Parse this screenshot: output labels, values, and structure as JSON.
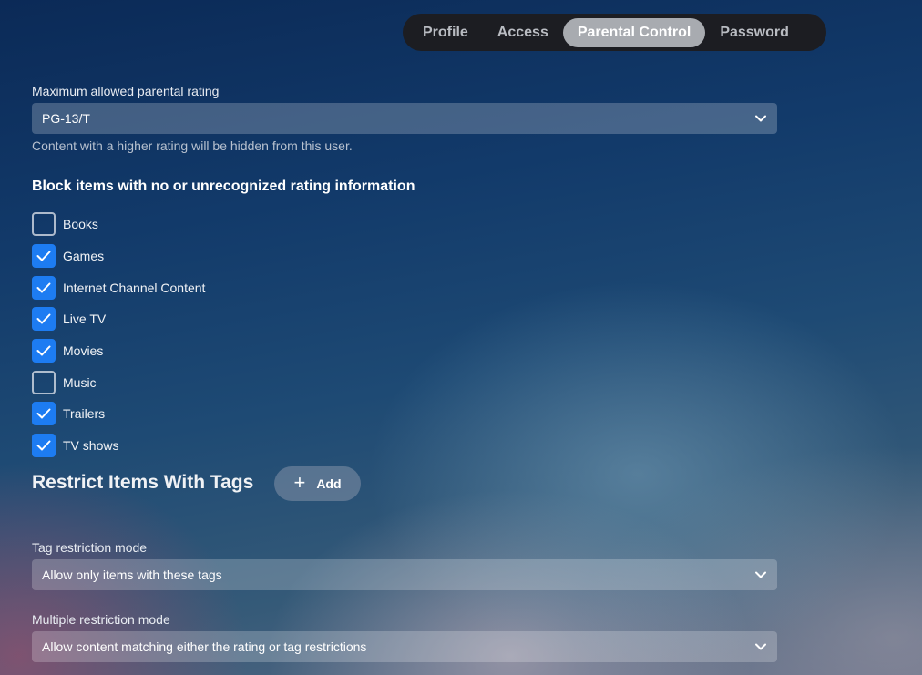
{
  "tabs": [
    {
      "label": "Profile",
      "active": false
    },
    {
      "label": "Access",
      "active": false
    },
    {
      "label": "Parental Control",
      "active": true
    },
    {
      "label": "Password",
      "active": false
    }
  ],
  "parental_rating": {
    "label": "Maximum allowed parental rating",
    "value": "PG-13/T",
    "helper": "Content with a higher rating will be hidden from this user."
  },
  "block_unrated": {
    "heading": "Block items with no or unrecognized rating information",
    "items": [
      {
        "label": "Books",
        "checked": false
      },
      {
        "label": "Games",
        "checked": true
      },
      {
        "label": "Internet Channel Content",
        "checked": true
      },
      {
        "label": "Live TV",
        "checked": true
      },
      {
        "label": "Movies",
        "checked": true
      },
      {
        "label": "Music",
        "checked": false
      },
      {
        "label": "Trailers",
        "checked": true
      },
      {
        "label": "TV shows",
        "checked": true
      }
    ]
  },
  "restrict_tags": {
    "title": "Restrict Items With Tags",
    "add_icon": "plus-icon",
    "add_label": "Add"
  },
  "tag_restriction_mode": {
    "label": "Tag restriction mode",
    "value": "Allow only items with these tags"
  },
  "multiple_restriction_mode": {
    "label": "Multiple restriction mode",
    "value": "Allow content matching either the rating or tag restrictions"
  },
  "colors": {
    "accent": "#1d7cf2",
    "tabbar_bg": "#1c1d22",
    "tab_active_bg": "#a8abb0"
  }
}
